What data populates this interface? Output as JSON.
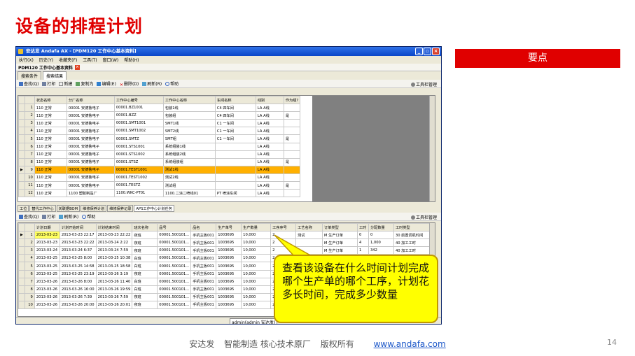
{
  "slide": {
    "title": "设备的排程计划",
    "keypoints_label": "要点",
    "footer": {
      "company": "安达发",
      "tagline": "智能制造 核心技术原厂",
      "rights": "版权所有",
      "url": "www.andafa.com"
    },
    "page_number": "14"
  },
  "window": {
    "title": "安达发 Andafa AX - [PDM120 工作中心基本资料]",
    "menu": [
      "执行(X)",
      "历史(Y)",
      "收藏夹(F)",
      "工具(T)",
      "窗口(W)",
      "帮助(H)"
    ],
    "doc_tab": "PDM120 工作中心基本资料",
    "sub_tabs": [
      "搜索条件",
      "搜索结果"
    ],
    "toolbar1": {
      "items": [
        "查找(Q)",
        "打印",
        "新建",
        "复制为",
        "编辑(E)",
        "删除(D)",
        "刷新(R)",
        "帮助"
      ],
      "manage": "工具栏管理"
    },
    "grid1": {
      "headers": [
        "状态名称",
        "分厂名称",
        "工作中心编号",
        "工作中心名称",
        "车间名称",
        "线别",
        "作为组?"
      ],
      "rows": [
        [
          "1",
          "110 正常",
          "00001 安德鲁电子",
          "00001.BZ1001",
          "包装1线",
          "C4 四车间",
          "LA A线",
          ""
        ],
        [
          "2",
          "110 正常",
          "00001 安德鲁电子",
          "00001.BZZ",
          "包装组",
          "C4 四车间",
          "LA A线",
          "是"
        ],
        [
          "3",
          "110 正常",
          "00001 安德鲁电子",
          "00001.SMT1001",
          "SMT1线",
          "C1 一车间",
          "LA A线",
          ""
        ],
        [
          "4",
          "110 正常",
          "00001 安德鲁电子",
          "00001.SMT1002",
          "SMT2线",
          "C1 一车间",
          "LA A线",
          ""
        ],
        [
          "5",
          "110 正常",
          "00001 安德鲁电子",
          "00001.SMTZ",
          "SMT组",
          "C1 一车间",
          "LA A线",
          "是"
        ],
        [
          "6",
          "110 正常",
          "00001 安德鲁电子",
          "00001.STS1001",
          "系统组装1线",
          "",
          "LA A线",
          ""
        ],
        [
          "7",
          "110 正常",
          "00001 安德鲁电子",
          "00001.STS1002",
          "系统组装2线",
          "",
          "LA A线",
          ""
        ],
        [
          "8",
          "110 正常",
          "00001 安德鲁电子",
          "00001.STSZ",
          "系统组装组",
          "",
          "LA A线",
          "是"
        ],
        [
          "9",
          "110 正常",
          "00001 安德鲁电子",
          "00001.TEST1001",
          "测试1线",
          "",
          "LA A线",
          ""
        ],
        [
          "10",
          "110 正常",
          "00001 安德鲁电子",
          "00001.TEST1002",
          "测试2线",
          "",
          "LA A线",
          ""
        ],
        [
          "11",
          "110 正常",
          "00001 安德鲁电子",
          "00001.TESTZ",
          "测试组",
          "",
          "LA A线",
          "是"
        ],
        [
          "12",
          "110 正常",
          "1100 塑胶制品厂",
          "1100.WKC-PT01",
          "1100.二涂二喷线01",
          "PT 喷涂车间",
          "LA A线",
          ""
        ]
      ],
      "selected_row": 9
    },
    "bottom_tabs": [
      "工位",
      "替代工作中心",
      "关联据BOM",
      "维修保养计划",
      "维修保养记录",
      "APS工作中心计划任务"
    ],
    "toolbar2": {
      "items": [
        "查找(Q)",
        "打印",
        "刷新(R)",
        "帮助"
      ],
      "manage": "工具栏管理"
    },
    "grid2": {
      "headers": [
        "计划日期",
        "计划开始时间",
        "计划结束时间",
        "班次名称",
        "品号",
        "品名",
        "生产单号",
        "生产数量",
        "工序序号",
        "工艺名称",
        "订单类型",
        "工时",
        "分配数量",
        "工时类型"
      ],
      "rows": [
        [
          "1",
          "2013-03-23",
          "2013-03-23 22:17",
          "2013-03-23 22:22",
          "夜班",
          "00001.500101...",
          "手机主板001",
          "1003695",
          "10,000",
          "2",
          "测试",
          "M 生产订单",
          "0",
          "0",
          "30 前置调机时间"
        ],
        [
          "2",
          "2013-03-23",
          "2013-03-23 22:22",
          "2013-03-24 2:22",
          "夜班",
          "00001.500101...",
          "手机主板001",
          "1003695",
          "10,000",
          "2",
          "",
          "M 生产订单",
          "4",
          "1,000",
          "40 加工工时"
        ],
        [
          "3",
          "2013-03-24",
          "2013-03-24 6:37",
          "2013-03-24 7:59",
          "夜班",
          "00001.500101...",
          "手机主板001",
          "1003695",
          "10,000",
          "2",
          "",
          "M 生产订单",
          "1",
          "342",
          "40 加工工时"
        ],
        [
          "4",
          "2013-03-25",
          "2013-03-25 8:00",
          "2013-03-25 10:38",
          "白班",
          "00001.500101...",
          "手机主板001",
          "1003695",
          "10,000",
          "2",
          "",
          "",
          "",
          "",
          ""
        ],
        [
          "5",
          "2013-03-25",
          "2013-03-25 14:58",
          "2013-03-25 18:58",
          "白班",
          "00001.500101...",
          "手机主板001",
          "1003695",
          "10,000",
          "2",
          "",
          "",
          "",
          "",
          ""
        ],
        [
          "6",
          "2013-03-25",
          "2013-03-25 23:19",
          "2013-03-26 3:19",
          "夜班",
          "00001.500101...",
          "手机主板001",
          "1003695",
          "10,000",
          "2",
          "",
          "",
          "",
          "",
          ""
        ],
        [
          "7",
          "2013-03-26",
          "2013-03-26 8:00",
          "2013-03-26 11:40",
          "白班",
          "00001.500101...",
          "手机主板001",
          "1003695",
          "10,000",
          "2",
          "",
          "",
          "",
          "",
          ""
        ],
        [
          "8",
          "2013-03-26",
          "2013-03-26 16:00",
          "2013-03-26 19:59",
          "白班",
          "00001.500101...",
          "手机主板001",
          "1003695",
          "10,000",
          "2",
          "",
          "",
          "",
          "",
          ""
        ],
        [
          "9",
          "2013-03-26",
          "2013-03-26 7:39",
          "2013-03-26 7:59",
          "夜班",
          "00001.500101...",
          "手机主板001",
          "1003695",
          "10,000",
          "2",
          "",
          "",
          "",
          "",
          ""
        ],
        [
          "10",
          "2013-03-26",
          "2013-03-26 20:00",
          "2013-03-26 20:01",
          "夜班",
          "00001.500101...",
          "手机主板001",
          "1003695",
          "10,000",
          "2",
          "",
          "",
          "",
          "",
          ""
        ]
      ]
    },
    "status_user": "admin(admin 安达发)"
  },
  "callout": {
    "text": "查看该设备在什么时间计划完成哪个生产单的哪个工序，计划花多长时间，完成多少数量"
  },
  "colors": {
    "title_red": "#e00000",
    "selected_row": "#ffb000",
    "callout_yellow": "#ffff00"
  }
}
